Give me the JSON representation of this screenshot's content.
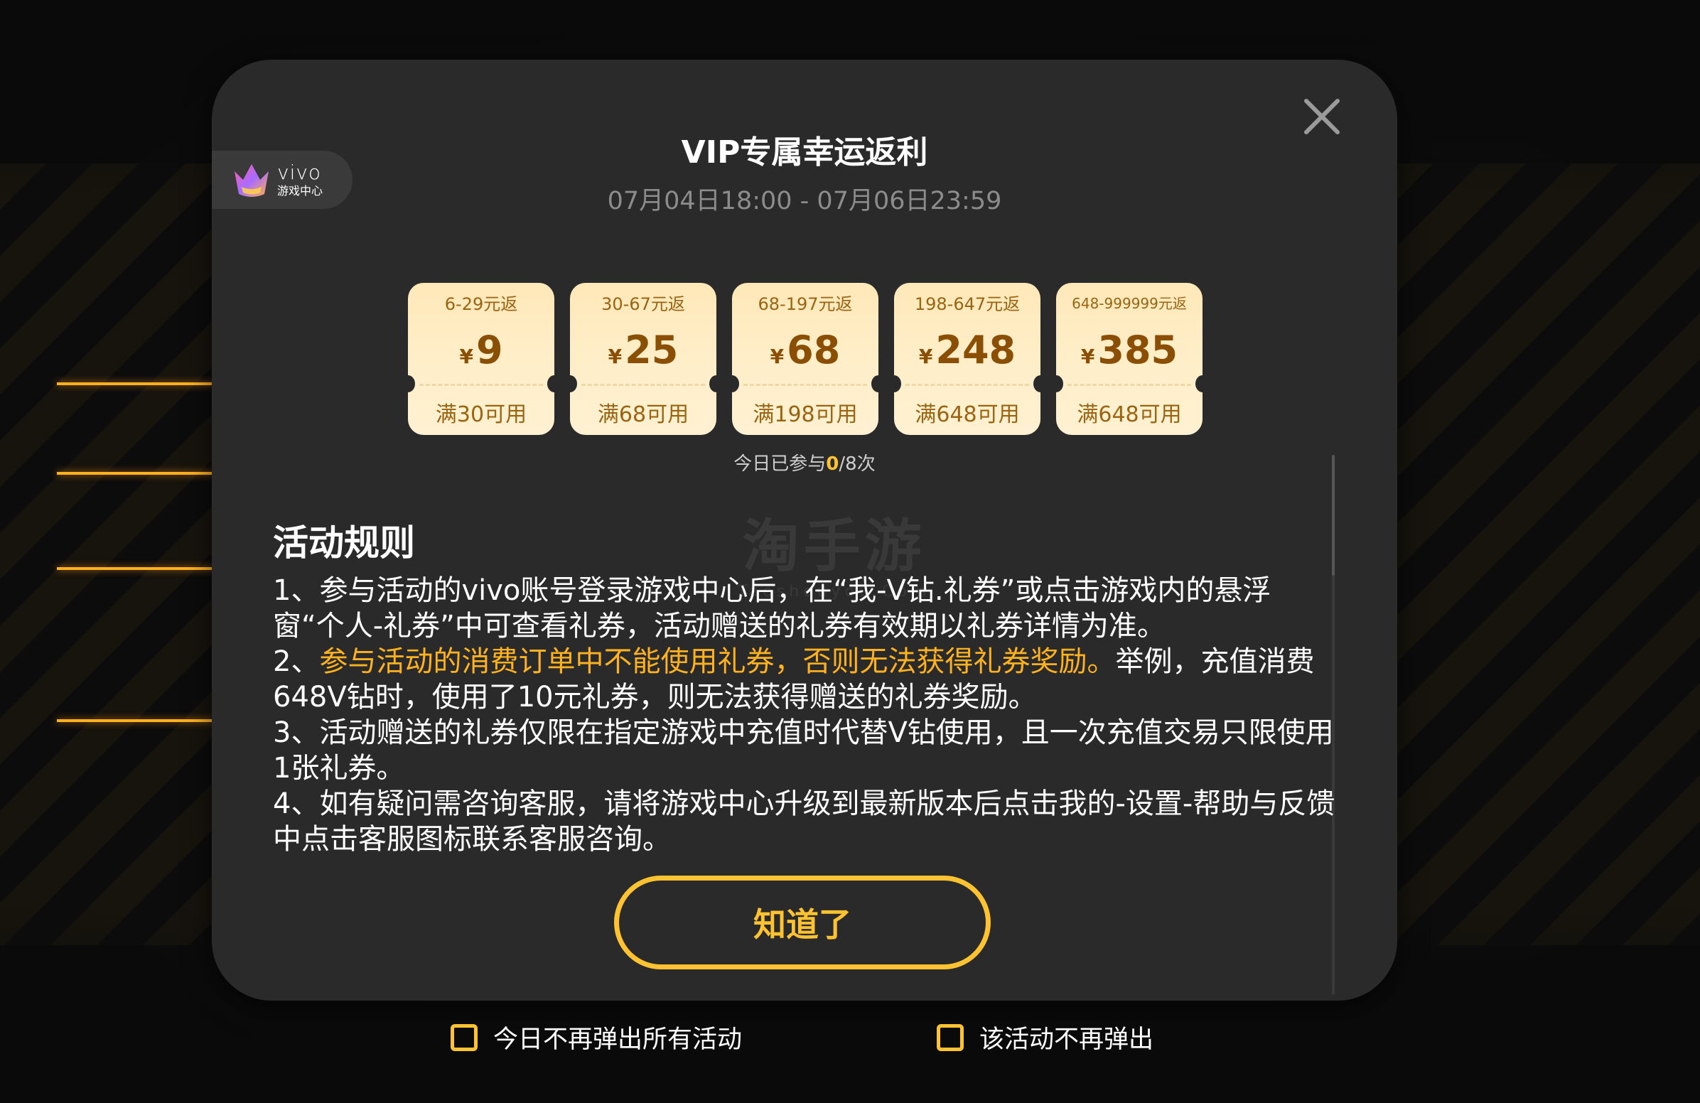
{
  "dialog": {
    "title": "VIP专属幸运返利",
    "time_range": "07月04日18:00 - 07月06日23:59",
    "badge": {
      "brand": "vivo",
      "sub": "游戏中心"
    },
    "coupons": [
      {
        "range": "6-29元返",
        "currency": "¥",
        "amount": "9",
        "condition": "满30可用"
      },
      {
        "range": "30-67元返",
        "currency": "¥",
        "amount": "25",
        "condition": "满68可用"
      },
      {
        "range": "68-197元返",
        "currency": "¥",
        "amount": "68",
        "condition": "满198可用"
      },
      {
        "range": "198-647元返",
        "currency": "¥",
        "amount": "248",
        "condition": "满648可用"
      },
      {
        "range": "648-999999元返",
        "currency": "¥",
        "amount": "385",
        "condition": "满648可用"
      }
    ],
    "participation": {
      "prefix": "今日已参与",
      "count": "0",
      "suffix": "/8次"
    },
    "rules_title": "活动规则",
    "rules": {
      "r1": "1、参与活动的vivo账号登录游戏中心后，在“我-V钻.礼券”或点击游戏内的悬浮窗“个人-礼券”中可查看礼券，活动赠送的礼券有效期以礼券详情为准。",
      "r2_prefix": "2、",
      "r2_highlight": "参与活动的消费订单中不能使用礼券，否则无法获得礼券奖励。",
      "r2_rest": "举例，充值消费648V钻时，使用了10元礼券，则无法获得赠送的礼券奖励。",
      "r3": "3、活动赠送的礼券仅限在指定游戏中充值时代替V钻使用，且一次充值交易只限使用1张礼券。",
      "r4": "4、如有疑问需咨询客服，请将游戏中心升级到最新版本后点击我的-设置-帮助与反馈中点击客服图标联系客服咨询。"
    },
    "ok_button": "知道了",
    "watermark": {
      "cn": "淘手游",
      "en": "Taoshouyou.Com"
    }
  },
  "options": {
    "today_label": "今日不再弹出所有活动",
    "this_label": "该活动不再弹出"
  },
  "colors": {
    "accent": "#ffc331",
    "highlight_text": "#ffb21f",
    "dialog_bg": "#2a2a2a",
    "coupon_bg": "#ffedc6"
  }
}
